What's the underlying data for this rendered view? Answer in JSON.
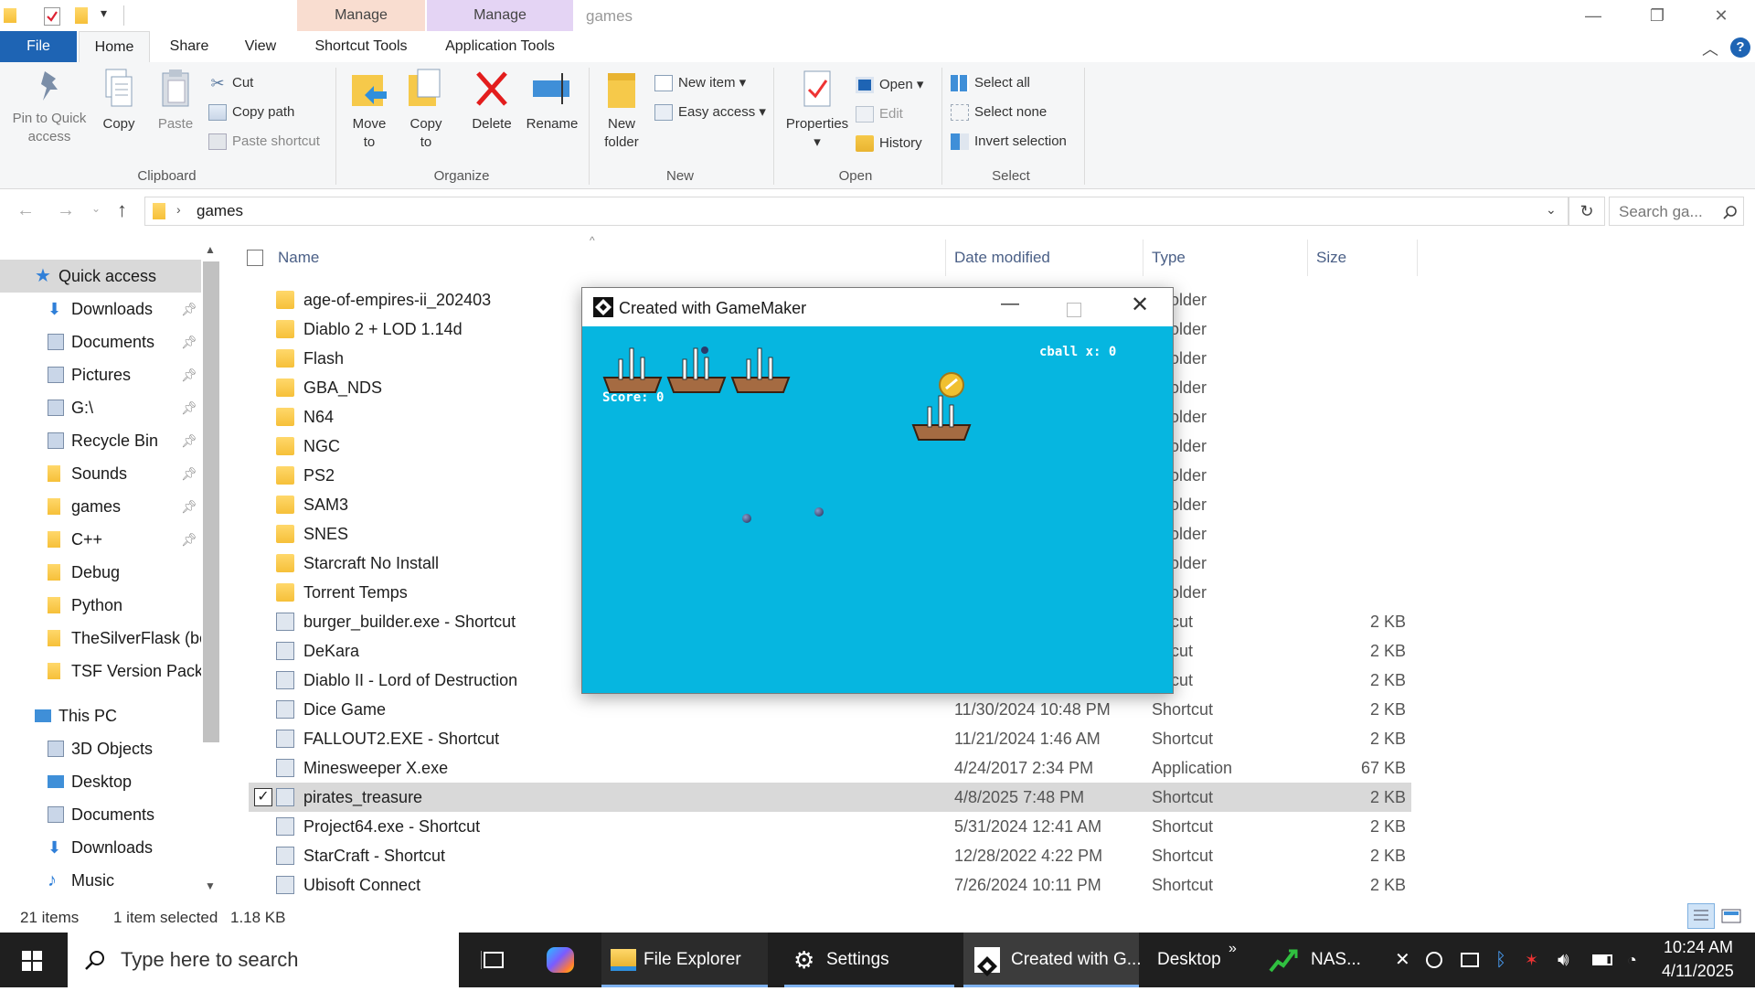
{
  "qat": {
    "customize_label": "▾"
  },
  "title_bar": {
    "context_tabs": [
      {
        "group": "Manage"
      },
      {
        "group": "Manage"
      }
    ],
    "window_title": "games",
    "minimize": "—",
    "restore": "❐",
    "close": "✕"
  },
  "ribbon_tabs": {
    "file": "File",
    "home": "Home",
    "share": "Share",
    "view": "View",
    "shortcut_tools": "Shortcut Tools",
    "application_tools": "Application Tools"
  },
  "ribbon": {
    "clipboard": {
      "pin": "Pin to Quick access",
      "copy": "Copy",
      "paste": "Paste",
      "cut": "Cut",
      "copy_path": "Copy path",
      "paste_shortcut": "Paste shortcut",
      "label": "Clipboard"
    },
    "organize": {
      "move_to": "Move to",
      "copy_to": "Copy to",
      "delete": "Delete",
      "rename": "Rename",
      "label": "Organize"
    },
    "new": {
      "new_folder": "New folder",
      "new_item": "New item",
      "easy_access": "Easy access",
      "label": "New"
    },
    "open": {
      "properties": "Properties",
      "open": "Open",
      "edit": "Edit",
      "history": "History",
      "label": "Open"
    },
    "select": {
      "select_all": "Select all",
      "select_none": "Select none",
      "invert": "Invert selection",
      "label": "Select"
    }
  },
  "address": {
    "path": "games",
    "search_placeholder": "Search ga..."
  },
  "columns": {
    "name": "Name",
    "date": "Date modified",
    "type": "Type",
    "size": "Size"
  },
  "nav": {
    "quick_access": "Quick access",
    "items": [
      "Downloads",
      "Documents",
      "Pictures",
      "G:\\",
      "Recycle Bin",
      "Sounds",
      "games",
      "C++",
      "Debug",
      "Python",
      "TheSilverFlask (bet",
      "TSF Version Packag"
    ],
    "this_pc": "This PC",
    "pc_items": [
      "3D Objects",
      "Desktop",
      "Documents",
      "Downloads",
      "Music"
    ]
  },
  "files": [
    {
      "name": "age-of-empires-ii_202403",
      "date": "",
      "type": "e folder",
      "size": ""
    },
    {
      "name": "Diablo 2 + LOD 1.14d",
      "date": "",
      "type": "e folder",
      "size": ""
    },
    {
      "name": "Flash",
      "date": "",
      "type": "e folder",
      "size": ""
    },
    {
      "name": "GBA_NDS",
      "date": "",
      "type": "e folder",
      "size": ""
    },
    {
      "name": "N64",
      "date": "",
      "type": "e folder",
      "size": ""
    },
    {
      "name": "NGC",
      "date": "",
      "type": "e folder",
      "size": ""
    },
    {
      "name": "PS2",
      "date": "",
      "type": "e folder",
      "size": ""
    },
    {
      "name": "SAM3",
      "date": "",
      "type": "e folder",
      "size": ""
    },
    {
      "name": "SNES",
      "date": "",
      "type": "e folder",
      "size": ""
    },
    {
      "name": "Starcraft No Install",
      "date": "",
      "type": "e folder",
      "size": ""
    },
    {
      "name": "Torrent Temps",
      "date": "",
      "type": "e folder",
      "size": ""
    },
    {
      "name": "burger_builder.exe - Shortcut",
      "date": "",
      "type": "ortcut",
      "size": "2 KB"
    },
    {
      "name": "DeKara",
      "date": "",
      "type": "ortcut",
      "size": "2 KB"
    },
    {
      "name": "Diablo II - Lord of Destruction",
      "date": "",
      "type": "ortcut",
      "size": "2 KB"
    },
    {
      "name": "Dice Game",
      "date": "11/30/2024 10:48 PM",
      "type": "Shortcut",
      "size": "2 KB"
    },
    {
      "name": "FALLOUT2.EXE - Shortcut",
      "date": "11/21/2024 1:46 AM",
      "type": "Shortcut",
      "size": "2 KB"
    },
    {
      "name": "Minesweeper X.exe",
      "date": "4/24/2017 2:34 PM",
      "type": "Application",
      "size": "67 KB"
    },
    {
      "name": "pirates_treasure",
      "date": "4/8/2025 7:48 PM",
      "type": "Shortcut",
      "size": "2 KB"
    },
    {
      "name": "Project64.exe - Shortcut",
      "date": "5/31/2024 12:41 AM",
      "type": "Shortcut",
      "size": "2 KB"
    },
    {
      "name": "StarCraft - Shortcut",
      "date": "12/28/2022 4:22 PM",
      "type": "Shortcut",
      "size": "2 KB"
    },
    {
      "name": "Ubisoft Connect",
      "date": "7/26/2024 10:11 PM",
      "type": "Shortcut",
      "size": "2 KB"
    }
  ],
  "status": {
    "count": "21 items",
    "selected": "1 item selected",
    "size": "1.18 KB"
  },
  "game_window": {
    "title": "Created with GameMaker",
    "score_text": "Score: 0",
    "cball_text": "cball x: 0"
  },
  "taskbar": {
    "search_placeholder": "Type here to search",
    "file_explorer": "File Explorer",
    "settings": "Settings",
    "gamemaker": "Created with G...",
    "desktop": "Desktop",
    "nas": "NAS...",
    "overflow": "»",
    "time": "10:24 AM",
    "date": "4/11/2025"
  },
  "colors": {
    "accent": "#1e64b4",
    "game_bg": "#06b6e0",
    "selection": "#d9d9d9",
    "taskbar": "#1f1f1f"
  }
}
